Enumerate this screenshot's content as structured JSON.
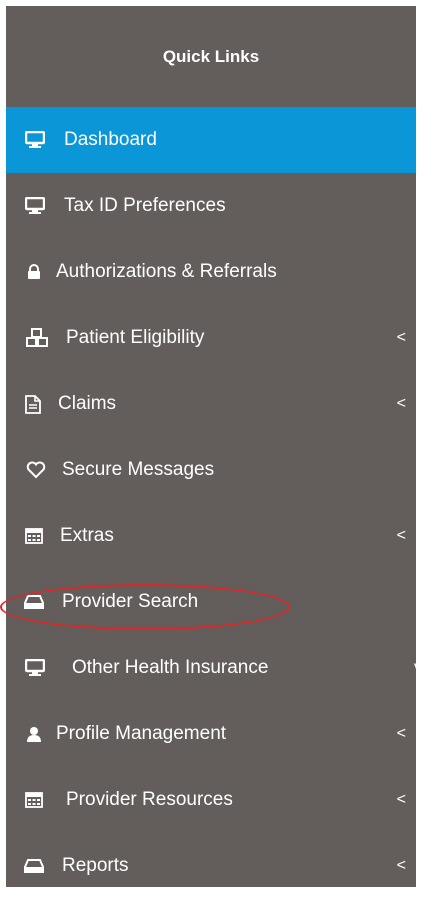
{
  "sidebar": {
    "title": "Quick Links",
    "items": [
      {
        "label": "Dashboard",
        "icon": "monitor-icon",
        "active": true,
        "chevron": ""
      },
      {
        "label": "Tax ID Preferences",
        "icon": "monitor-icon",
        "chevron": ""
      },
      {
        "label": "Authorizations & Referrals",
        "icon": "lock-icon",
        "chevron": ""
      },
      {
        "label": "Patient Eligibility",
        "icon": "cubes-icon",
        "chevron": "<"
      },
      {
        "label": "Claims",
        "icon": "document-icon",
        "chevron": "<"
      },
      {
        "label": "Secure Messages",
        "icon": "heart-icon",
        "chevron": ""
      },
      {
        "label": "Extras",
        "icon": "calculator-icon",
        "chevron": "<"
      },
      {
        "label": "Provider Search",
        "icon": "hdd-icon",
        "chevron": "",
        "highlighted": true
      },
      {
        "label": "Other Health Insurance",
        "icon": "monitor-icon",
        "chevron": "v"
      },
      {
        "label": "Profile Management",
        "icon": "user-icon",
        "chevron": "<"
      },
      {
        "label": "Provider Resources",
        "icon": "calculator-icon",
        "chevron": "<"
      },
      {
        "label": "Reports",
        "icon": "hdd-icon",
        "chevron": "<"
      }
    ]
  },
  "colors": {
    "sidebar_bg": "#635d5c",
    "active_bg": "#0b96d8",
    "text": "#ffffff",
    "highlight_outline": "#e02626"
  }
}
